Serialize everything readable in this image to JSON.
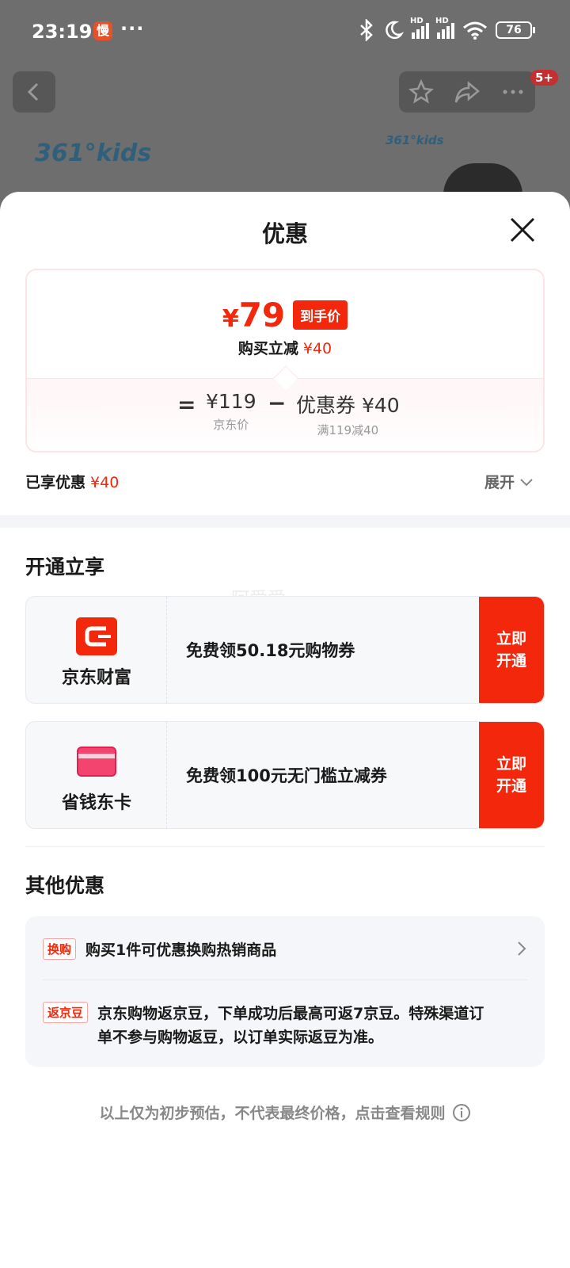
{
  "status_bar": {
    "time": "23:19",
    "app_icon_text": "慢",
    "more_dots": "···",
    "hd1": "HD",
    "hd2": "HD",
    "battery": "76"
  },
  "background_page": {
    "brand_logo": "361°kids",
    "brand_logo_small": "361°kids",
    "badge_count": "5+"
  },
  "sheet": {
    "title": "优惠",
    "price_card": {
      "final_price_symbol": "¥",
      "final_price": "79",
      "final_price_tag": "到手价",
      "discount_label": "购买立减",
      "discount_value": "¥40",
      "equals": "=",
      "jd_price": "¥119",
      "jd_price_label": "京东价",
      "minus": "−",
      "coupon_value": "优惠券 ¥40",
      "coupon_rule": "满119减40"
    },
    "enjoyed_label": "已享优惠",
    "enjoyed_value": "¥40",
    "expand_label": "展开"
  },
  "open_section": {
    "title": "开通立享",
    "watermark": "阿爱爱",
    "cards": [
      {
        "name": "京东财富",
        "text": "免费领50.18元购物券",
        "button": "立即开通",
        "color": "#f2270c"
      },
      {
        "name": "省钱东卡",
        "text": "免费领100元无门槛立减券",
        "button": "立即开通",
        "color": "#f2270c"
      }
    ]
  },
  "other_section": {
    "title": "其他优惠",
    "items": [
      {
        "tag": "换购",
        "text": "购买1件可优惠换购热销商品"
      },
      {
        "tag": "返京豆",
        "text": "京东购物返京豆，下单成功后最高可返7京豆。特殊渠道订单不参与购物返豆，以订单实际返豆为准。"
      }
    ]
  },
  "footer_note": "以上仅为初步预估，不代表最终价格，点击查看规则",
  "colors": {
    "accent": "#f2270c",
    "muted": "#999999"
  }
}
